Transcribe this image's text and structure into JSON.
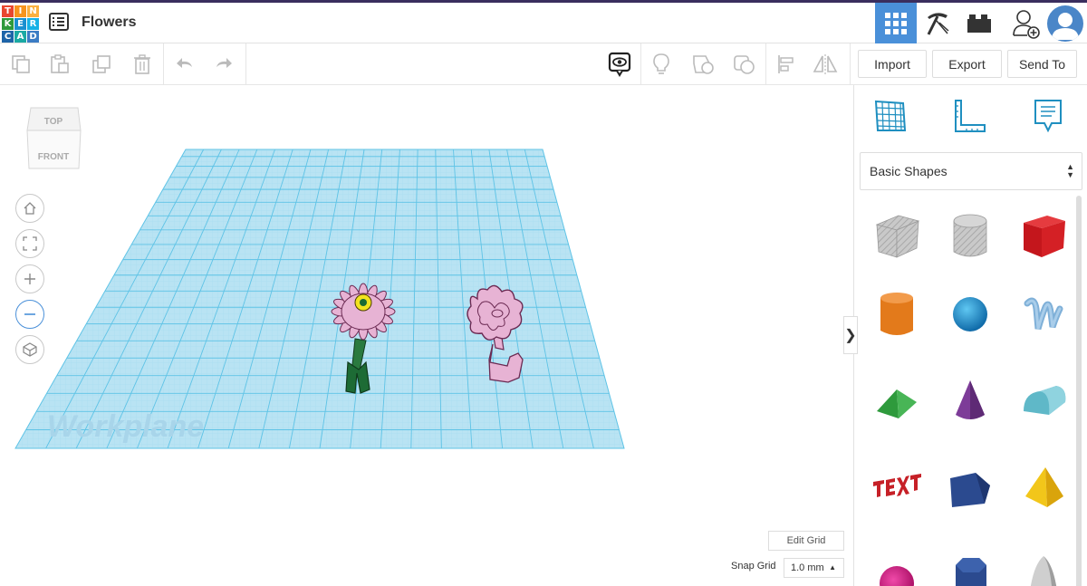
{
  "app": {
    "logo_letters": [
      "T",
      "I",
      "N",
      "K",
      "E",
      "R",
      "C",
      "A",
      "D"
    ],
    "design_title": "Flowers"
  },
  "topbar": {
    "icons": [
      "3d-view-icon",
      "build-icon",
      "bricks-icon",
      "add-user-icon"
    ],
    "active_color": "#4a90d9"
  },
  "toolbar": {
    "edit_icons": [
      "copy-icon",
      "paste-icon",
      "duplicate-icon",
      "delete-icon",
      "undo-icon",
      "redo-icon"
    ],
    "view_icons": [
      "notes-icon",
      "light-icon",
      "shape-group-icon",
      "hole-shape-icon",
      "align-icon",
      "mirror-icon"
    ],
    "import_label": "Import",
    "export_label": "Export",
    "send_to_label": "Send To"
  },
  "viewport": {
    "viewcube_top": "TOP",
    "viewcube_front": "FRONT",
    "workplane_label": "Workplane",
    "nav_icons": [
      "home-icon",
      "fit-view-icon",
      "zoom-in-icon",
      "zoom-out-icon",
      "perspective-icon"
    ],
    "edit_grid_label": "Edit Grid",
    "snap_grid_label": "Snap Grid",
    "snap_grid_value": "1.0 mm",
    "collapse_glyph": "❯"
  },
  "panel": {
    "tools": [
      "workplane-icon",
      "ruler-icon",
      "notes-icon"
    ],
    "category": "Basic Shapes",
    "shapes": [
      "box-hole",
      "cylinder-hole",
      "box",
      "cylinder",
      "sphere",
      "scribble",
      "roof",
      "cone",
      "round-roof",
      "text",
      "polygon-prism",
      "pyramid",
      "half-sphere",
      "hexagonal-prism",
      "paraboloid"
    ],
    "colors": {
      "box": "#d42025",
      "cylinder": "#e37a1b",
      "sphere": "#1a8fd0",
      "roof": "#2e9a3c",
      "cone": "#7d3c98",
      "round_roof": "#5fb8c8",
      "text": "#c62027",
      "polygon": "#2b4a8f",
      "pyramid": "#f2c61a",
      "half_sphere": "#d6137f"
    }
  },
  "colors": {
    "grid_fill": "#b9e3f3",
    "grid_line": "#5ec3e6",
    "flower_pink": "#e7b3d4",
    "stem_green": "#1d6b35",
    "accent": "#4a90d9"
  }
}
